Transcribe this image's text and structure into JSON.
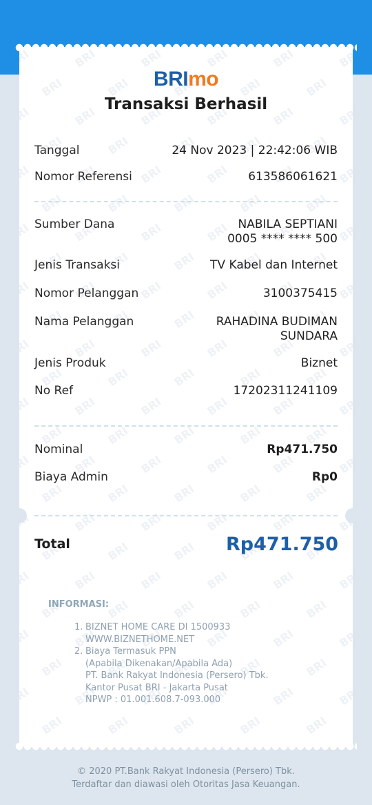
{
  "brand": {
    "logo_main": "BRI",
    "logo_suffix": "mo",
    "watermark_text": "BRI"
  },
  "title": "Transaksi Berhasil",
  "details_top": [
    {
      "label": "Tanggal",
      "value": "24 Nov 2023 | 22:42:06 WIB"
    },
    {
      "label": "Nomor Referensi",
      "value": "613586061621"
    }
  ],
  "details_mid": [
    {
      "label": "Sumber Dana",
      "value_line1": "NABILA SEPTIANI",
      "value_line2": "0005 **** **** 500"
    },
    {
      "label": "Jenis Transaksi",
      "value": "TV Kabel dan Internet"
    },
    {
      "label": "Nomor Pelanggan",
      "value": "3100375415"
    },
    {
      "label": "Nama Pelanggan",
      "value_line1": "RAHADINA BUDIMAN",
      "value_line2": "SUNDARA"
    },
    {
      "label": "Jenis Produk",
      "value": "Biznet"
    },
    {
      "label": "No Ref",
      "value": "17202311241109"
    }
  ],
  "amounts": [
    {
      "label": "Nominal",
      "value": "Rp471.750"
    },
    {
      "label": "Biaya Admin",
      "value": "Rp0"
    }
  ],
  "total": {
    "label": "Total",
    "value": "Rp471.750"
  },
  "info": {
    "heading": "INFORMASI:",
    "items": [
      {
        "num": "1.",
        "lines": [
          "BIZNET HOME CARE DI 1500933",
          "WWW.BIZNETHOME.NET"
        ]
      },
      {
        "num": "2.",
        "lines": [
          "Biaya Termasuk PPN",
          "(Apabila Dikenakan/Apabila Ada)",
          "PT. Bank Rakyat Indonesia (Persero) Tbk.",
          "Kantor Pusat BRI - Jakarta Pusat",
          "NPWP : 01.001.608.7-093.000"
        ]
      }
    ]
  },
  "footer": {
    "line1": "© 2020 PT.Bank Rakyat Indonesia (Persero) Tbk.",
    "line2": "Terdaftar dan diawasi oleh Otoritas Jasa Keuangan."
  },
  "colors": {
    "header_blue": "#1f8fe6",
    "brand_blue": "#1d5fa8",
    "brand_orange": "#f07a22",
    "page_bg": "#dde6ef"
  }
}
